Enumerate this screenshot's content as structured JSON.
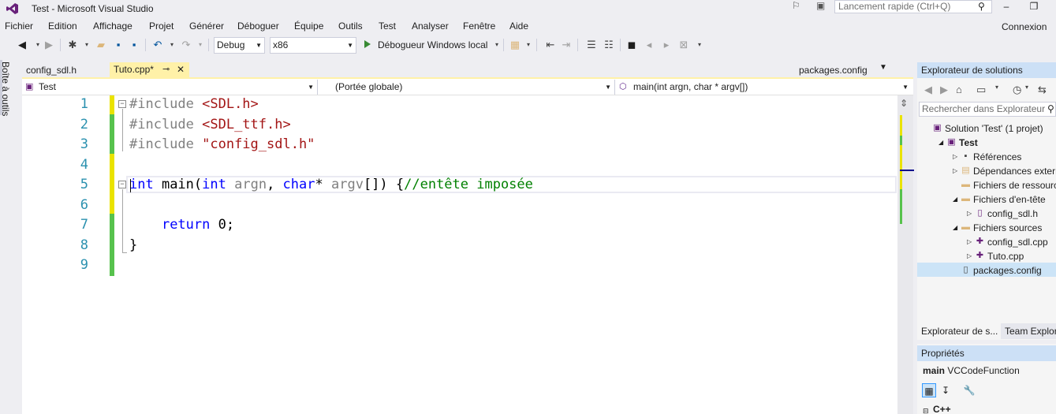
{
  "window": {
    "title": "Test - Microsoft Visual Studio",
    "quick_launch_placeholder": "Lancement rapide (Ctrl+Q)",
    "minimize": "–",
    "maximize": "❐",
    "account": "Connexion"
  },
  "menu": [
    "Fichier",
    "Edition",
    "Affichage",
    "Projet",
    "Générer",
    "Déboguer",
    "Équipe",
    "Outils",
    "Test",
    "Analyser",
    "Fenêtre",
    "Aide"
  ],
  "toolbar": {
    "configuration": "Debug",
    "platform": "x86",
    "debugger": "Débogueur Windows local"
  },
  "toolbox": {
    "label": "Boîte à outils"
  },
  "tabs": {
    "inactive": "config_sdl.h",
    "active": "Tuto.cpp*",
    "pin": "⊸",
    "close": "✕",
    "preview": "packages.config"
  },
  "navbar": {
    "project": "Test",
    "scope": "(Portée globale)",
    "member": "main(int argn, char * argv[])"
  },
  "editor": {
    "line_numbers": [
      "1",
      "2",
      "3",
      "4",
      "5",
      "6",
      "7",
      "8",
      "9"
    ],
    "lines": [
      {
        "parts": [
          [
            "pp",
            "#include "
          ],
          [
            "str",
            "<SDL.h>"
          ]
        ]
      },
      {
        "parts": [
          [
            "pp",
            "#include "
          ],
          [
            "str",
            "<SDL_ttf.h>"
          ]
        ]
      },
      {
        "parts": [
          [
            "pp",
            "#include "
          ],
          [
            "str",
            "\"config_sdl.h\""
          ]
        ]
      },
      {
        "parts": []
      },
      {
        "parts": [
          [
            "kw",
            "int"
          ],
          [
            "fn",
            " main("
          ],
          [
            "kw",
            "int"
          ],
          [
            "fn",
            " "
          ],
          [
            "prm",
            "argn"
          ],
          [
            "fn",
            ", "
          ],
          [
            "kw",
            "char"
          ],
          [
            "fn",
            "* "
          ],
          [
            "prm",
            "argv"
          ],
          [
            "fn",
            "[]) {"
          ],
          [
            "cmt",
            "//entête imposée"
          ]
        ]
      },
      {
        "parts": []
      },
      {
        "parts": [
          [
            "fn",
            "    "
          ],
          [
            "kw",
            "return"
          ],
          [
            "fn",
            " 0;"
          ]
        ]
      },
      {
        "parts": [
          [
            "fn",
            "}"
          ]
        ]
      },
      {
        "parts": []
      }
    ]
  },
  "solution_explorer": {
    "title": "Explorateur de solutions",
    "search_placeholder": "Rechercher dans Explorateur",
    "items": [
      {
        "label": "Solution 'Test' (1 projet)",
        "bold": false
      },
      {
        "label": "Test",
        "bold": true
      },
      {
        "label": "Références",
        "bold": false
      },
      {
        "label": "Dépendances externes",
        "bold": false
      },
      {
        "label": "Fichiers de ressources",
        "bold": false
      },
      {
        "label": "Fichiers d'en-tête",
        "bold": false
      },
      {
        "label": "config_sdl.h",
        "bold": false
      },
      {
        "label": "Fichiers sources",
        "bold": false
      },
      {
        "label": "config_sdl.cpp",
        "bold": false
      },
      {
        "label": "Tuto.cpp",
        "bold": false
      },
      {
        "label": "packages.config",
        "bold": false
      }
    ],
    "bottom_tabs": [
      "Explorateur de s...",
      "Team Explorer"
    ]
  },
  "properties": {
    "title": "Propriétés",
    "object_name": "main",
    "object_type": "VCCodeFunction",
    "category": "C++"
  }
}
